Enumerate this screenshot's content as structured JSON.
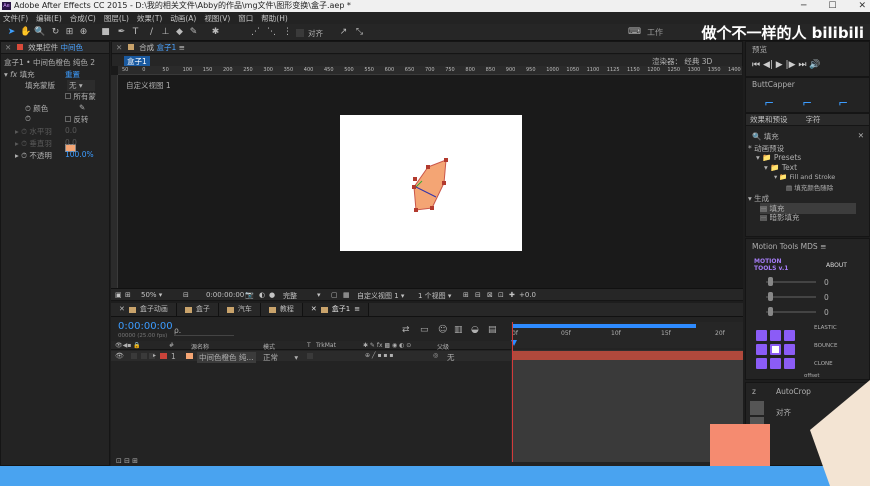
{
  "window": {
    "title": "Adobe After Effects CC 2015 - D:\\我的相关文件\\Abby的作品\\mg文件\\图形变换\\盒子.aep *",
    "app_icon": "Ae",
    "watermark": "做个不一样的人 bilibili",
    "workspace": "工作"
  },
  "menu": [
    "文件(F)",
    "编辑(E)",
    "合成(C)",
    "图层(L)",
    "效果(T)",
    "动画(A)",
    "视图(V)",
    "窗口",
    "帮助(H)"
  ],
  "toolbar": {
    "align_label": "对齐"
  },
  "effects_panel": {
    "tab_label": "效果控件",
    "tab_highlight": "中间色",
    "breadcrumb": "盒子1 • 中间色橙色 纯色 2",
    "effect_name": "填充",
    "reset_label": "重置",
    "fill_mask_label": "填充蒙版",
    "fill_mask_value": "无",
    "all_masks_label": "所有蒙",
    "color_label": "颜色",
    "color_value": "#f4a574",
    "invert_label": "反转",
    "h_feather_label": "水平羽",
    "h_feather_value": "0.0",
    "v_feather_label": "垂直羽",
    "v_feather_value": "0.0",
    "opacity_label": "不透明",
    "opacity_value": "100.0%"
  },
  "composition": {
    "tab_label": "合成",
    "comp_name": "盒子1",
    "breadcrumb": "盒子1",
    "renderer_label": "渲染器：",
    "renderer_value": "经典 3D",
    "view_label": "自定义视图 1",
    "ruler_ticks": [
      "50",
      "0",
      "50",
      "100",
      "150",
      "200",
      "250",
      "300",
      "350",
      "400",
      "450",
      "500",
      "550",
      "600",
      "650",
      "700",
      "750",
      "800",
      "850",
      "900",
      "950",
      "1000",
      "1050",
      "1100",
      "1125",
      "1150",
      "1200",
      "1250",
      "1300",
      "1350",
      "1400"
    ],
    "shape_color": "#f4a574",
    "footer": {
      "zoom": "50%",
      "timecode": "0:00:00:00",
      "quality": "完整",
      "view": "自定义视图 1",
      "views": "1 个视图",
      "offset": "+0.0"
    }
  },
  "timeline": {
    "tabs": [
      {
        "label": "盒子动画"
      },
      {
        "label": "盒子"
      },
      {
        "label": "汽车"
      },
      {
        "label": "教程"
      },
      {
        "label": "盒子1",
        "active": true
      }
    ],
    "timecode": "0:00:00:00",
    "frame_info": "00000 (25.00 fps)",
    "search_placeholder": "ρ.",
    "columns": {
      "num": "#",
      "source": "源名称",
      "mode": "模式",
      "t": "T",
      "trkmat": "TrkMat",
      "parent": "父级"
    },
    "ruler_marks": [
      "0f",
      "05f",
      "10f",
      "15f",
      "20f"
    ],
    "layers": [
      {
        "num": "1",
        "name": "中间色橙色 纯...",
        "mode": "正常",
        "parent": "无",
        "color": "#c9433a"
      }
    ]
  },
  "right": {
    "preview_tab": "预览",
    "buttcapper_tab": "ButtCapper",
    "effects_tab": "效果和预设",
    "char_tab": "字符",
    "search_value": "填充",
    "tree": {
      "animation_presets": "* 动画预设",
      "presets": "Presets",
      "text": "Text",
      "fill_and_stroke": "Fill and Stroke",
      "fill_color_erase": "填充颜色随除",
      "generate": "生成",
      "fill": "填充",
      "gradient_fill": "暗影填充"
    },
    "motion_tools": {
      "tab_label": "Motion Tools MDS",
      "logo": "MOTION TOOLS v.1",
      "about": "ABOUT",
      "values": [
        "0",
        "0",
        "0"
      ],
      "elastic": "ELASTIC",
      "bounce": "BOUNCE",
      "clone": "CLONE",
      "offset": "offset"
    },
    "autocrop_tab": "AutoCrop",
    "align_tab": "对齐",
    "z_label": "z"
  },
  "colors": {
    "accent_blue": "#3c9cff",
    "timeline_blue": "#2e8bff",
    "layer_red": "#b0493c",
    "purple": "#8b5cf6",
    "bottom_blue": "#49a3f0",
    "salmon": "#f58b70"
  }
}
